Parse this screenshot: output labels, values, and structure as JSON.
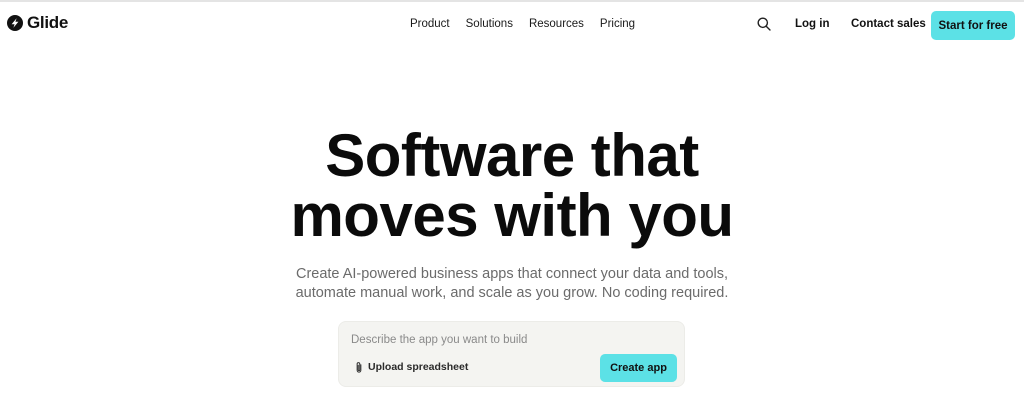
{
  "brand": {
    "name": "Glide",
    "logo_icon": "glide-logo-icon"
  },
  "nav": {
    "links": [
      {
        "label": "Product"
      },
      {
        "label": "Solutions"
      },
      {
        "label": "Resources"
      },
      {
        "label": "Pricing"
      }
    ],
    "search_icon": "search-icon",
    "login_label": "Log in",
    "contact_label": "Contact sales",
    "cta_label": "Start for free"
  },
  "hero": {
    "title_line1": "Software that",
    "title_line2": "moves with you",
    "subtitle_line1": "Create AI-powered business apps that connect your data and tools,",
    "subtitle_line2": "automate manual work, and scale as you grow. No coding required."
  },
  "prompt": {
    "placeholder": "Describe the app you want to build",
    "value": "",
    "upload_label": "Upload spreadsheet",
    "upload_icon": "paperclip-icon",
    "submit_label": "Create app"
  },
  "colors": {
    "accent": "#5ce1e6",
    "text": "#111111",
    "muted": "#6b6b6b",
    "prompt_bg": "#f4f4f1"
  }
}
